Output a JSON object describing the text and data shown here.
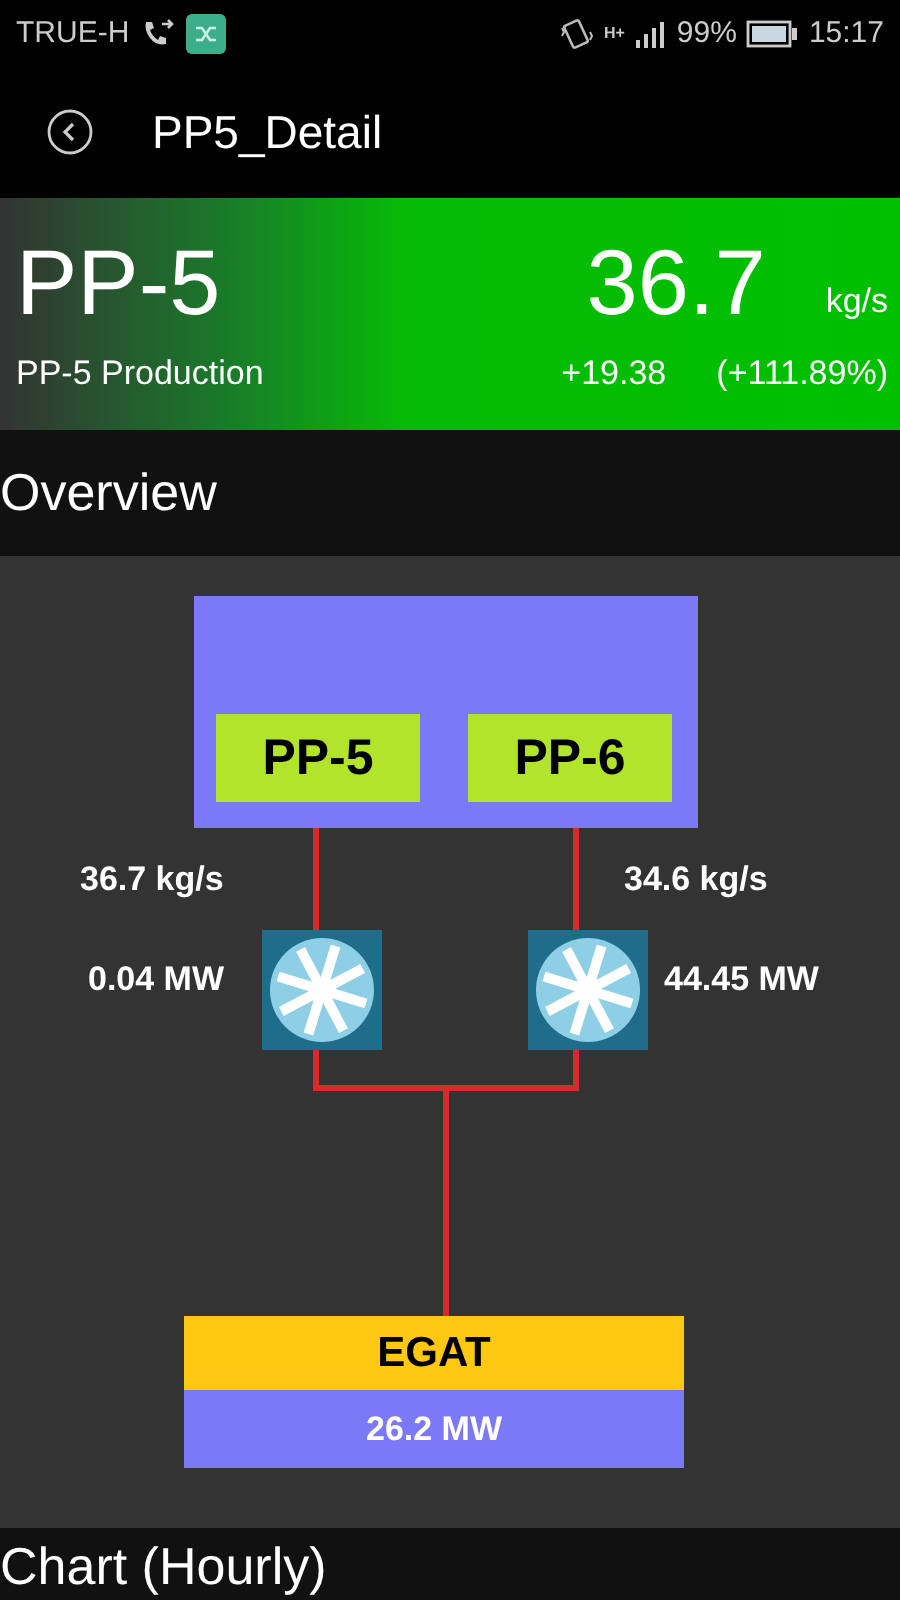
{
  "status_bar": {
    "carrier": "TRUE-H",
    "network": "H+",
    "battery": "99%",
    "time": "15:17"
  },
  "app_bar": {
    "title": "PP5_Detail"
  },
  "summary": {
    "name": "PP-5",
    "value": "36.7",
    "unit": "kg/s",
    "subtitle": "PP-5 Production",
    "change": "+19.38",
    "change_percent": "(+111.89%)"
  },
  "overview": {
    "title": "Overview",
    "units": [
      {
        "name": "PP-5",
        "flow": "36.7 kg/s",
        "power": "0.04 MW"
      },
      {
        "name": "PP-6",
        "flow": "34.6 kg/s",
        "power": "44.45 MW"
      }
    ],
    "grid": {
      "name": "EGAT",
      "power": "26.2 MW"
    }
  },
  "chart": {
    "title": "Chart (Hourly)"
  }
}
